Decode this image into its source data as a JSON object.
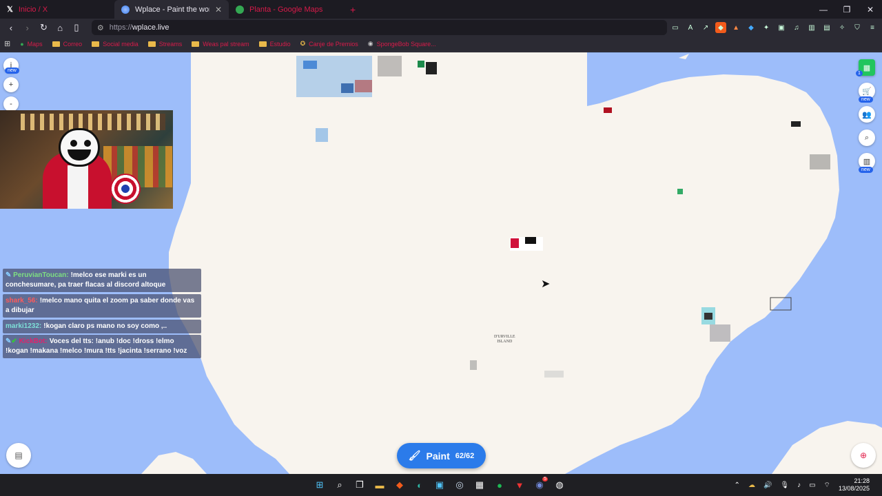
{
  "browser": {
    "tabs": [
      {
        "title": "Inicio / X",
        "favicon": "x-logo-icon",
        "active": false
      },
      {
        "title": "Wplace - Paint the world",
        "favicon": "globe-icon",
        "active": true
      },
      {
        "title": "Planta - Google Maps",
        "favicon": "maps-pin-icon",
        "active": false
      }
    ],
    "url_protocol": "https://",
    "url_host": "wplace.live",
    "bookmarks": [
      {
        "label": "Maps",
        "type": "link"
      },
      {
        "label": "Correo",
        "type": "folder"
      },
      {
        "label": "Social media",
        "type": "folder"
      },
      {
        "label": "Streams",
        "type": "folder"
      },
      {
        "label": "Weas pal stream",
        "type": "folder"
      },
      {
        "label": "Estudio",
        "type": "folder"
      },
      {
        "label": "Canje de Premios",
        "type": "link"
      },
      {
        "label": "SpongeBob Square...",
        "type": "link"
      }
    ]
  },
  "map": {
    "land_color": "#f8f4ee",
    "water_color": "#9dbdfa",
    "island_label_line1": "D'URVILLE",
    "island_label_line2": "ISLAND",
    "zoom": {
      "info": "i",
      "info_badge": "new",
      "plus": "+",
      "minus": "-"
    }
  },
  "chat": [
    {
      "user": "PeruvianToucan:",
      "user_color": "#7ee081",
      "message": "!melco ese marki es un conchesumare, pa traer flacas al discord altoque"
    },
    {
      "user": "shark_56:",
      "user_color": "#ff5a5a",
      "message": "!melco mano quita el zoom pa saber donde vas a dibujar"
    },
    {
      "user": "marki1232:",
      "user_color": "#7ee0d8",
      "message": "!kogan claro ps mano no soy como ,.."
    },
    {
      "user": "KickBot:",
      "user_color": "#e0226b",
      "message": "Voces del tts: !anub !doc !dross !elmo !kogan !makana !melco !mura !tts !jacinta !serrano !voz"
    }
  ],
  "right_panel": {
    "avatar_badge": "1",
    "store_badge": "new",
    "leaderboard_badge": "new"
  },
  "paint_button": {
    "label": "Paint",
    "charges": "62/62"
  },
  "taskbar": {
    "time": "21:28",
    "date": "13/08/2025",
    "discord_badge": "5"
  }
}
